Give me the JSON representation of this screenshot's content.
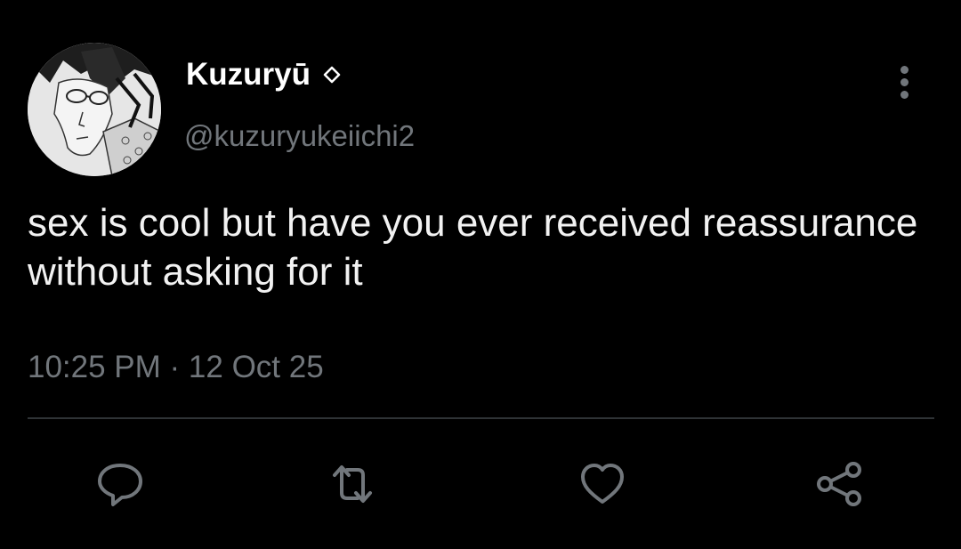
{
  "author": {
    "display_name": "Kuzuryū",
    "handle": "@kuzuryukeiichi2",
    "badge_icon": "diamond-outline-icon",
    "avatar": "manga-character-portrait"
  },
  "tweet": {
    "text": "sex is cool but have you ever received reassurance without asking for it",
    "timestamp": "10:25 PM · 12 Oct 25"
  },
  "actions": [
    {
      "name": "reply",
      "icon": "speech-bubble-icon"
    },
    {
      "name": "retweet",
      "icon": "retweet-arrows-icon"
    },
    {
      "name": "like",
      "icon": "heart-icon"
    },
    {
      "name": "share",
      "icon": "share-nodes-icon"
    }
  ],
  "menu": {
    "icon": "vertical-ellipsis-icon"
  },
  "colors": {
    "background": "#000000",
    "primary_text": "#ffffff",
    "secondary_text": "#71767b",
    "divider": "#2f3336"
  }
}
